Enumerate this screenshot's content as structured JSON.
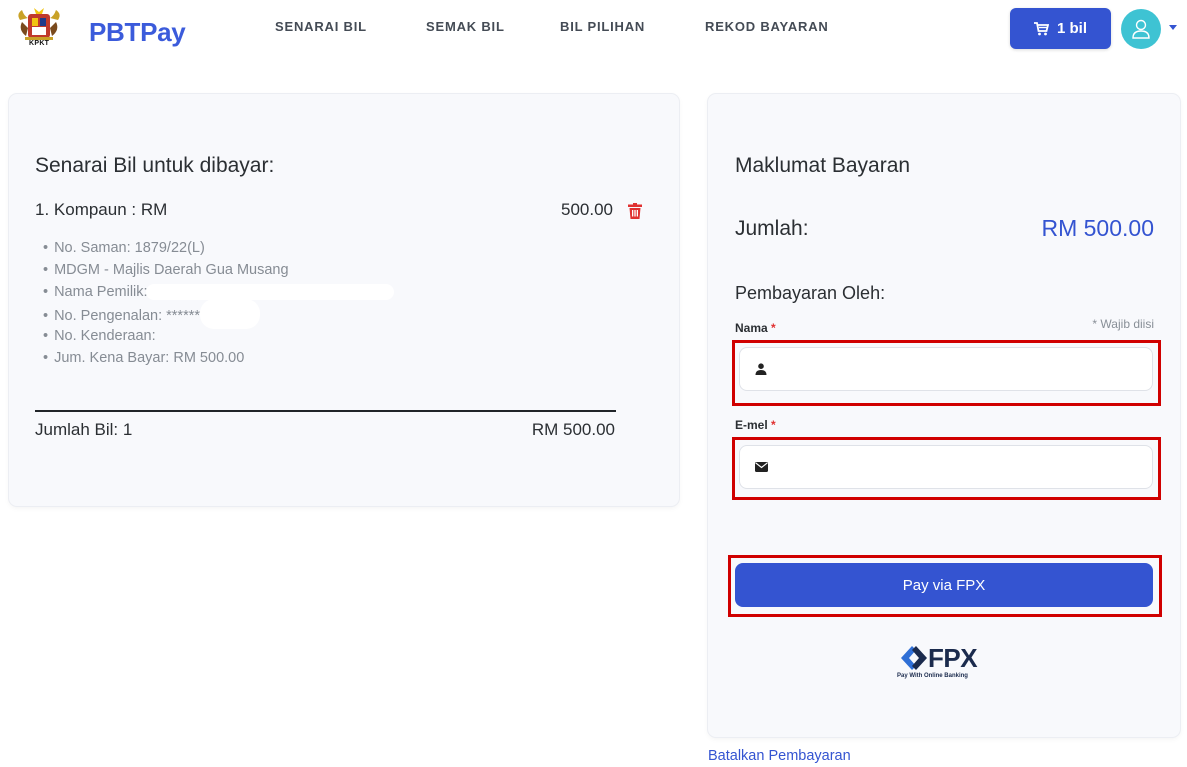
{
  "header": {
    "brand": "PBTPay",
    "crest_label": "KPKT",
    "nav": [
      "SENARAI BIL",
      "SEMAK BIL",
      "BIL PILIHAN",
      "REKOD BAYARAN"
    ],
    "cart_label": "1 bil"
  },
  "bills": {
    "title": "Senarai Bil untuk dibayar:",
    "item_head": "1. Kompaun : RM",
    "item_amount": "500.00",
    "details": [
      "No. Saman: 1879/22(L)",
      "MDGM - Majlis Daerah Gua Musang",
      "Nama Pemilik:",
      "No. Pengenalan: *******",
      "No. Kenderaan:",
      "Jum. Kena Bayar: RM 500.00"
    ],
    "total_label": "Jumlah Bil: 1",
    "total_amount": "RM 500.00"
  },
  "payment": {
    "title": "Maklumat Bayaran",
    "jumlah_label": "Jumlah:",
    "jumlah_value": "RM 500.00",
    "oleh": "Pembayaran Oleh:",
    "nama_label": "Nama",
    "required_mark": "*",
    "wajib": "* Wajib diisi",
    "email_label": "E-mel",
    "nama_value": "",
    "email_value": "",
    "pay_button": "Pay via FPX",
    "fpx_logo": "FPX",
    "fpx_sub": "Pay With Online Banking"
  },
  "cancel_link": "Batalkan Pembayaran"
}
